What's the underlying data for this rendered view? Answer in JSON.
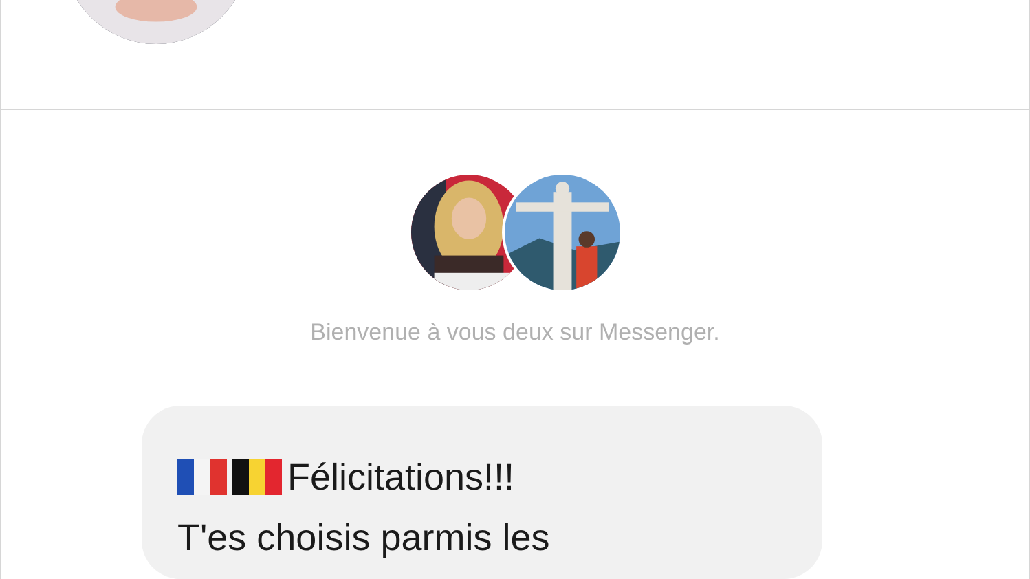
{
  "conversation": {
    "welcome": "Bienvenue à vous deux sur Messenger.",
    "message": {
      "flags": [
        {
          "kind": "france"
        },
        {
          "kind": "belgium"
        }
      ],
      "title": "Félicitations!!!",
      "lines": [
        "T'es choisis parmis les"
      ]
    }
  }
}
